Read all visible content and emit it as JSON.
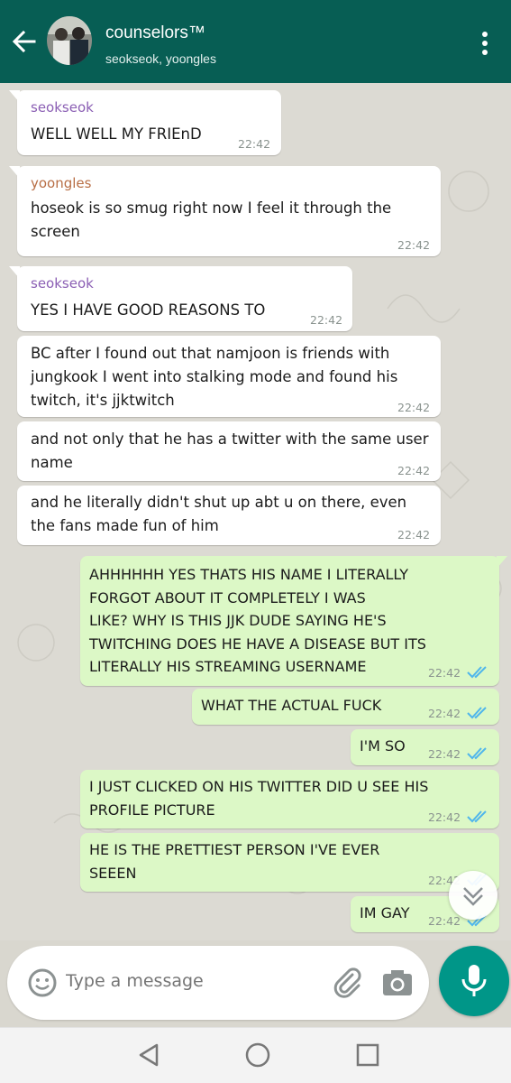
{
  "header": {
    "title": "counselors™",
    "subtitle": "seokseok, yoongles",
    "back_icon": "arrow-left-icon",
    "menu_icon": "more-vert-icon"
  },
  "colors": {
    "header": "#075e54",
    "incoming": "#ffffff",
    "outgoing": "#dcf8c6",
    "seokseok": "#8b5fb4",
    "yoongles": "#b86e45",
    "read_ticks": "#4fb6ec",
    "mic": "#009688"
  },
  "messages": [
    {
      "sender": "seokseok",
      "text": "WELL WELL MY FRIEnD",
      "time": "22:42"
    },
    {
      "sender": "yoongles",
      "text": "hoseok is so smug right now I feel it through the\nscreen",
      "time": "22:42"
    },
    {
      "sender": "seokseok",
      "text": "YES I HAVE GOOD REASONS TO",
      "time": "22:42"
    },
    {
      "text": "BC after I found out that namjoon is friends with\njungkook I went into stalking mode and found his\ntwitch, it's jjktwitch",
      "time": "22:42"
    },
    {
      "text": "and not only that he has a twitter with the same user\nname",
      "time": "22:42"
    },
    {
      "text": "and he literally didn't shut up abt u on there, even\nthe fans made fun of him",
      "time": "22:42"
    },
    {
      "text": "AHHHHHH YES THATS HIS NAME I LITERALLY\nFORGOT ABOUT IT COMPLETELY I WAS\nLIKE? WHY IS THIS JJK DUDE SAYING HE'S\nTWITCHING DOES HE HAVE A DISEASE BUT ITS\nLITERALLY HIS STREAMING USERNAME",
      "time": "22:42"
    },
    {
      "text": "WHAT THE ACTUAL FUCK",
      "time": "22:42"
    },
    {
      "text": "I'M SO",
      "time": "22:42"
    },
    {
      "text": "I JUST CLICKED ON HIS TWITTER DID U SEE HIS\nPROFILE PICTURE",
      "time": "22:42"
    },
    {
      "text": "HE IS THE PRETTIEST PERSON I'VE EVER\nSEEEN",
      "time": "22:42"
    },
    {
      "text": "IM GAY",
      "time": "22:42"
    }
  ],
  "composer": {
    "placeholder": "Type a message",
    "emoji_icon": "emoji-icon",
    "attach_icon": "paperclip-icon",
    "camera_icon": "camera-icon",
    "mic_icon": "microphone-icon"
  },
  "scroll_icon": "double-chevron-down-icon",
  "navbar": {
    "back_icon": "nav-back-icon",
    "home_icon": "nav-home-icon",
    "recents_icon": "nav-recents-icon"
  }
}
